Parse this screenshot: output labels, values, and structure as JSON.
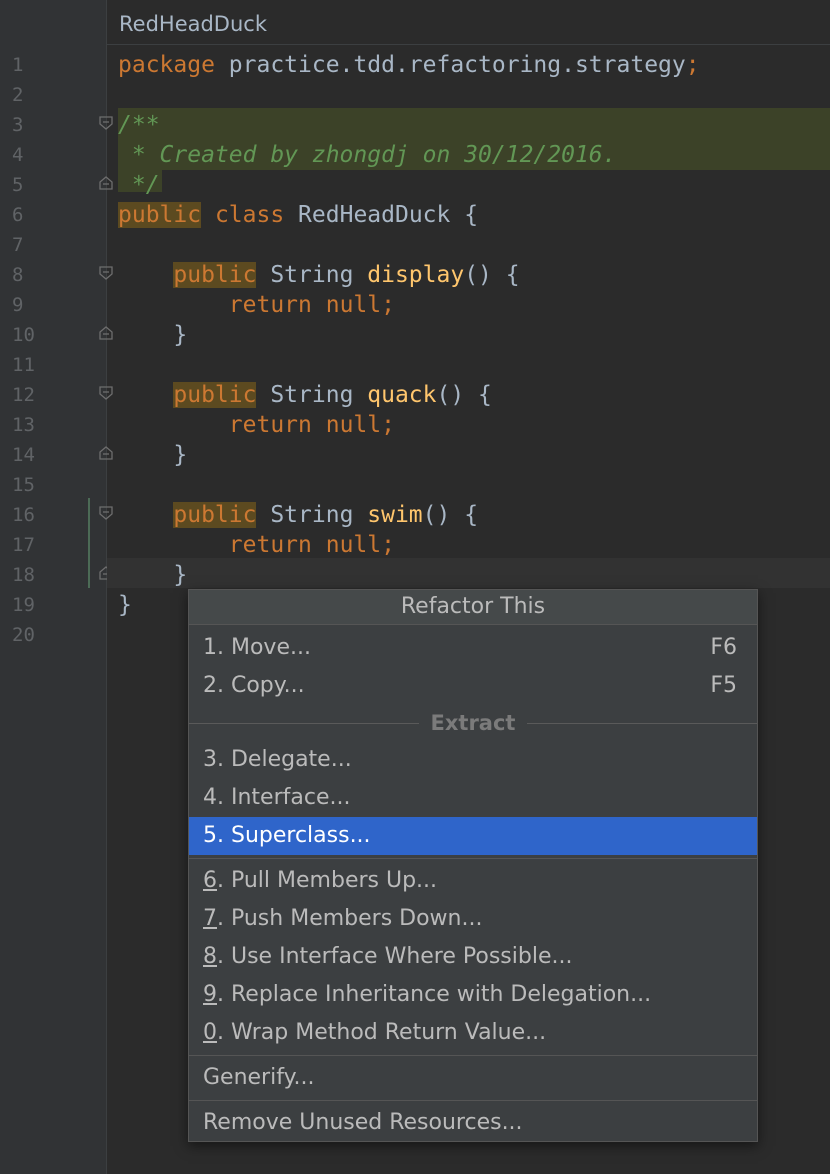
{
  "editor": {
    "tab_title": "RedHeadDuck",
    "line_numbers": [
      "1",
      "2",
      "3",
      "4",
      "5",
      "6",
      "7",
      "8",
      "9",
      "10",
      "11",
      "12",
      "13",
      "14",
      "15",
      "16",
      "17",
      "18",
      "19",
      "20"
    ],
    "code": {
      "l1_kw": "package",
      "l1_rest": " practice.tdd.refactoring.strategy",
      "l1_semi": ";",
      "l3": "/**",
      "l4": " * Created by zhongdj on 30/12/2016.",
      "l5": " */",
      "l6_kw1": "public",
      "l6_kw2": "class",
      "l6_name": " RedHeadDuck {",
      "public_kw": "public",
      "string_type": " String ",
      "m1_name": "display",
      "m2_name": "quack",
      "m3_name": "swim",
      "paren_open": "() {",
      "return_kw": "return",
      "null_kw": "null",
      "semi": ";",
      "close_brace": "}"
    }
  },
  "popup": {
    "title": "Refactor This",
    "items": [
      {
        "label": "1. Move...",
        "shortcut": "F6"
      },
      {
        "label": "2. Copy...",
        "shortcut": "F5"
      }
    ],
    "extract_title": "Extract",
    "extract_items": [
      {
        "label": "3. Delegate..."
      },
      {
        "label": "4. Interface..."
      },
      {
        "label": "5. Superclass..."
      }
    ],
    "member_items": [
      {
        "num": "6",
        "rest": ". Pull Members Up..."
      },
      {
        "num": "7",
        "rest": ". Push Members Down..."
      },
      {
        "num": "8",
        "rest": ". Use Interface Where Possible..."
      },
      {
        "num": "9",
        "rest": ". Replace Inheritance with Delegation..."
      },
      {
        "num": "0",
        "rest": ". Wrap Method Return Value..."
      }
    ],
    "generify": "Generify...",
    "remove_unused": "Remove Unused Resources..."
  },
  "colors": {
    "keyword": "#cc7832",
    "function": "#ffc66d",
    "comment": "#629755",
    "selection": "#2f65ca"
  }
}
